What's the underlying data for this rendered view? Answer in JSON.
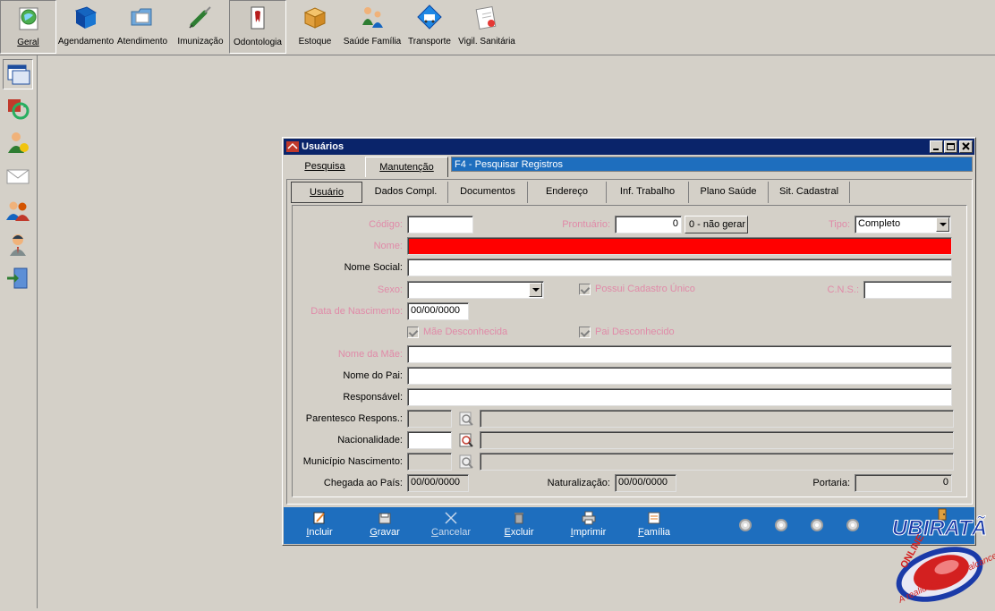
{
  "toolbar": {
    "items": [
      {
        "label": "Geral",
        "icon": "globe-doc-icon"
      },
      {
        "label": "Agendamento",
        "icon": "blue-book-icon"
      },
      {
        "label": "Atendimento",
        "icon": "folder-icon"
      },
      {
        "label": "Imunização",
        "icon": "syringe-icon"
      },
      {
        "label": "Odontologia",
        "icon": "tooth-icon"
      },
      {
        "label": "Estoque",
        "icon": "box-icon"
      },
      {
        "label": "Saúde Família",
        "icon": "family-icon"
      },
      {
        "label": "Transporte",
        "icon": "ambulance-icon"
      },
      {
        "label": "Vigil. Sanitária",
        "icon": "document-stamp-icon"
      }
    ]
  },
  "window": {
    "title": "Usuários",
    "tabs": [
      "Pesquisa",
      "Manutenção"
    ],
    "hint": "F4 - Pesquisar Registros",
    "inner_tabs": [
      "Usuário",
      "Dados Compl.",
      "Documentos",
      "Endereço",
      "Inf. Trabalho",
      "Plano Saúde",
      "Sit. Cadastral"
    ]
  },
  "form": {
    "codigo_label": "Código:",
    "codigo_value": "",
    "prontuario_label": "Prontuário:",
    "prontuario_value": "0",
    "nao_gerar_label": "0 - não gerar",
    "tipo_label": "Tipo:",
    "tipo_value": "Completo",
    "nome_label": "Nome:",
    "nome_value": "",
    "nome_social_label": "Nome Social:",
    "sexo_label": "Sexo:",
    "possui_cadastro_label": "Possui Cadastro Único",
    "cns_label": "C.N.S.:",
    "data_nasc_label": "Data de Nascimento:",
    "data_nasc_value": "00/00/0000",
    "mae_desconhecida_label": "Mãe Desconhecida",
    "pai_desconhecido_label": "Pai Desconhecido",
    "nome_mae_label": "Nome da Mãe:",
    "nome_pai_label": "Nome do Pai:",
    "responsavel_label": "Responsável:",
    "parentesco_label": "Parentesco Respons.:",
    "nacionalidade_label": "Nacionalidade:",
    "municipio_label": "Município Nascimento:",
    "chegada_label": "Chegada ao País:",
    "chegada_value": "00/00/0000",
    "naturalizacao_label": "Naturalização:",
    "naturalizacao_value": "00/00/0000",
    "portaria_label": "Portaria:",
    "portaria_value": "0"
  },
  "actions": [
    {
      "label": "Incluir",
      "u": "I",
      "rest": "ncluir",
      "icon": "edit-icon"
    },
    {
      "label": "Gravar",
      "u": "G",
      "rest": "ravar",
      "icon": "save-icon"
    },
    {
      "label": "Cancelar",
      "u": "C",
      "rest": "ancelar",
      "icon": "cancel-icon"
    },
    {
      "label": "Excluir",
      "u": "E",
      "rest": "xcluir",
      "icon": "trash-icon"
    },
    {
      "label": "Imprimir",
      "u": "I",
      "rest": "mprimir",
      "icon": "printer-icon"
    },
    {
      "label": "Família",
      "u": "F",
      "rest": "amília",
      "icon": "family-doc-icon"
    }
  ],
  "logo": {
    "brand": "UBIRATÃ",
    "online": "ONLINE",
    "tagline": "A realidade ao seu alcance!"
  },
  "colors": {
    "titlebar": "#0a246a",
    "action_bar": "#1e6ebe",
    "required_label": "#e08aa8",
    "error_field": "#ff0000"
  }
}
